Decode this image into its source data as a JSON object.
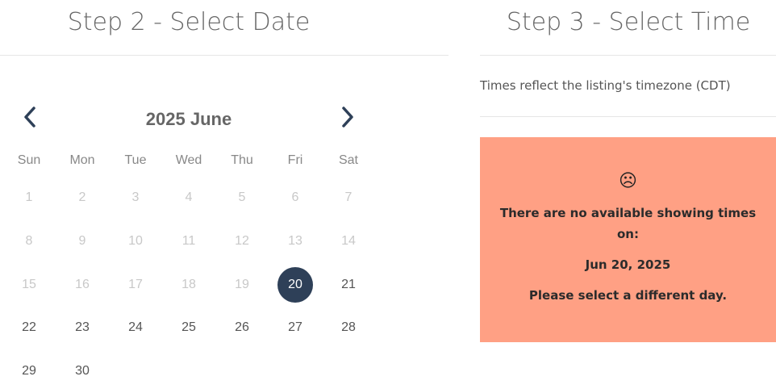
{
  "step2": {
    "title": "Step 2 - Select Date"
  },
  "calendar": {
    "month_label": "2025 June",
    "prev_icon": "chevron-left-icon",
    "next_icon": "chevron-right-icon",
    "weekdays": [
      "Sun",
      "Mon",
      "Tue",
      "Wed",
      "Thu",
      "Fri",
      "Sat"
    ],
    "weeks": [
      [
        {
          "d": "1",
          "s": "disabled"
        },
        {
          "d": "2",
          "s": "disabled"
        },
        {
          "d": "3",
          "s": "disabled"
        },
        {
          "d": "4",
          "s": "disabled"
        },
        {
          "d": "5",
          "s": "disabled"
        },
        {
          "d": "6",
          "s": "disabled"
        },
        {
          "d": "7",
          "s": "disabled"
        }
      ],
      [
        {
          "d": "8",
          "s": "disabled"
        },
        {
          "d": "9",
          "s": "disabled"
        },
        {
          "d": "10",
          "s": "disabled"
        },
        {
          "d": "11",
          "s": "disabled"
        },
        {
          "d": "12",
          "s": "disabled"
        },
        {
          "d": "13",
          "s": "disabled"
        },
        {
          "d": "14",
          "s": "disabled"
        }
      ],
      [
        {
          "d": "15",
          "s": "disabled"
        },
        {
          "d": "16",
          "s": "disabled"
        },
        {
          "d": "17",
          "s": "disabled"
        },
        {
          "d": "18",
          "s": "disabled"
        },
        {
          "d": "19",
          "s": "disabled"
        },
        {
          "d": "20",
          "s": "selected"
        },
        {
          "d": "21",
          "s": "available"
        }
      ],
      [
        {
          "d": "22",
          "s": "available"
        },
        {
          "d": "23",
          "s": "available"
        },
        {
          "d": "24",
          "s": "available"
        },
        {
          "d": "25",
          "s": "available"
        },
        {
          "d": "26",
          "s": "available"
        },
        {
          "d": "27",
          "s": "available"
        },
        {
          "d": "28",
          "s": "available"
        }
      ],
      [
        {
          "d": "29",
          "s": "available"
        },
        {
          "d": "30",
          "s": "available"
        }
      ]
    ],
    "selected_color": "#2e4058",
    "disabled_color": "#c8c8c8"
  },
  "step3": {
    "title": "Step 3 - Select Time",
    "timezone_note": "Times reflect the listing's timezone (CDT)",
    "no_times": {
      "icon": "sad-face-icon",
      "icon_glyph": "☹",
      "message": "There are no available showing times on:",
      "date": "Jun 20, 2025",
      "hint": "Please select a different day.",
      "background_color": "#ffa084"
    }
  }
}
